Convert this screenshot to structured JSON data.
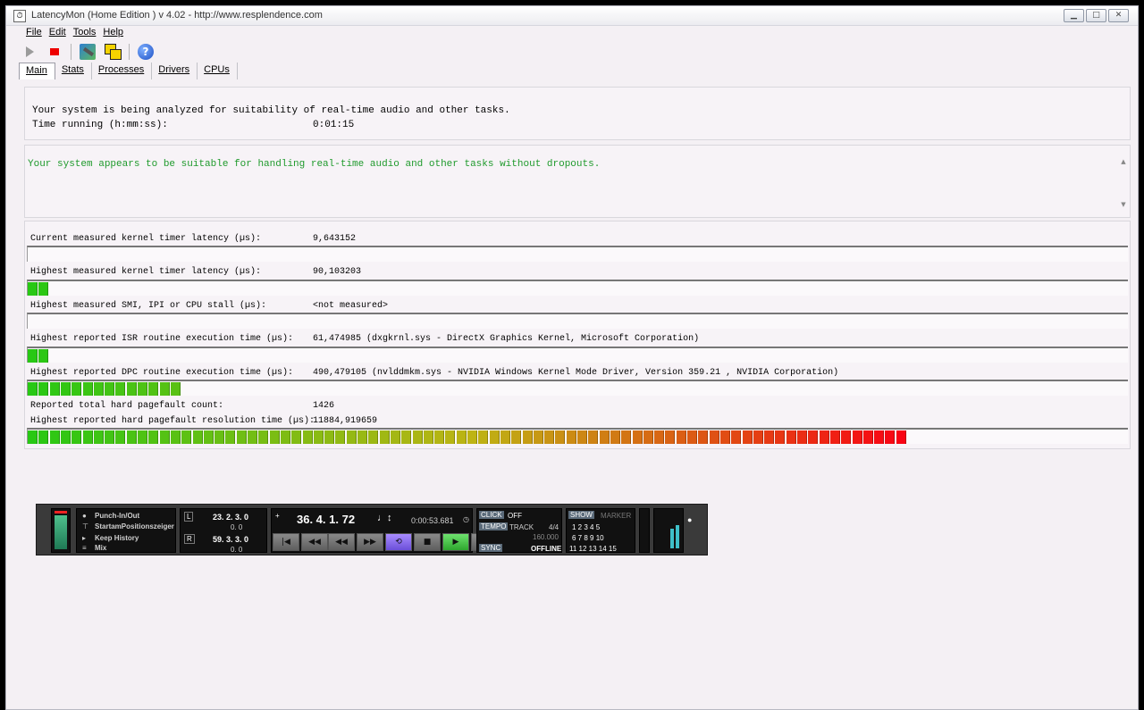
{
  "window": {
    "title": "LatencyMon  (Home Edition )  v 4.02 - http://www.resplendence.com",
    "minimize": "▁",
    "maximize": "□",
    "close": "✕"
  },
  "menu": [
    "File",
    "Edit",
    "Tools",
    "Help"
  ],
  "toolbar": {
    "help": "?"
  },
  "tabs": [
    "Main",
    "Stats",
    "Processes",
    "Drivers",
    "CPUs"
  ],
  "status": {
    "analyzing": "Your system is being analyzed for suitability of real-time audio and other tasks.",
    "time_label": "Time running (h:mm:ss):",
    "time_value": "0:01:15"
  },
  "verdict": "Your system appears to be suitable for handling real-time audio and other tasks without dropouts.",
  "metrics": [
    {
      "label": "Current measured kernel timer latency (µs):",
      "value": "9,643152",
      "bar_fraction": 0.0
    },
    {
      "label": "Highest measured kernel timer latency (µs):",
      "value": "90,103203",
      "bar_fraction": 0.02
    },
    {
      "label": "Highest measured SMI, IPI or CPU stall (µs):",
      "value": "<not measured>",
      "bar_fraction": 0.0
    },
    {
      "label": "Highest reported ISR routine execution time (µs):",
      "value": "61,474985  (dxgkrnl.sys - DirectX Graphics Kernel, Microsoft Corporation)",
      "bar_fraction": 0.02
    },
    {
      "label": "Highest reported DPC routine execution time (µs):",
      "value": "490,479105  (nvlddmkm.sys - NVIDIA Windows Kernel Mode Driver, Version 359.21 , NVIDIA Corporation)",
      "bar_fraction": 0.14
    }
  ],
  "pagefault": {
    "count_label": "Reported total hard pagefault count:",
    "count_value": "1426",
    "time_label": "Highest reported hard pagefault resolution time (µs):",
    "time_value": "11884,919659",
    "bar_fraction": 0.8
  },
  "transport": {
    "punch": "Punch-In/Out",
    "start_pos": "StartamPositionszeiger",
    "keep_history": "Keep History",
    "mix": "Mix",
    "left_locator": "23. 2. 3.   0",
    "left_sub": "0.   0",
    "right_locator": "59. 3. 3.   0",
    "right_sub": "0.   0",
    "position": "36.  4.  1.  72",
    "time": "0:00:53.681",
    "click": "CLICK",
    "click_value": "OFF",
    "tempo": "TEMPO",
    "tempo_mode": "TRACK",
    "signature": "4/4",
    "bpm": "160.000",
    "sync": "SYNC",
    "sync_value": "OFFLINE",
    "show": "SHOW",
    "marker": "MARKER",
    "marker_row1": "1   2   3   4   5",
    "marker_row2": "6   7   8   9  10",
    "marker_row3": "11 12 13 14 15",
    "buttons": [
      "|◀",
      "◀◀",
      "◀◀",
      "▶▶",
      "⟲",
      "■",
      "▶",
      "●"
    ]
  }
}
